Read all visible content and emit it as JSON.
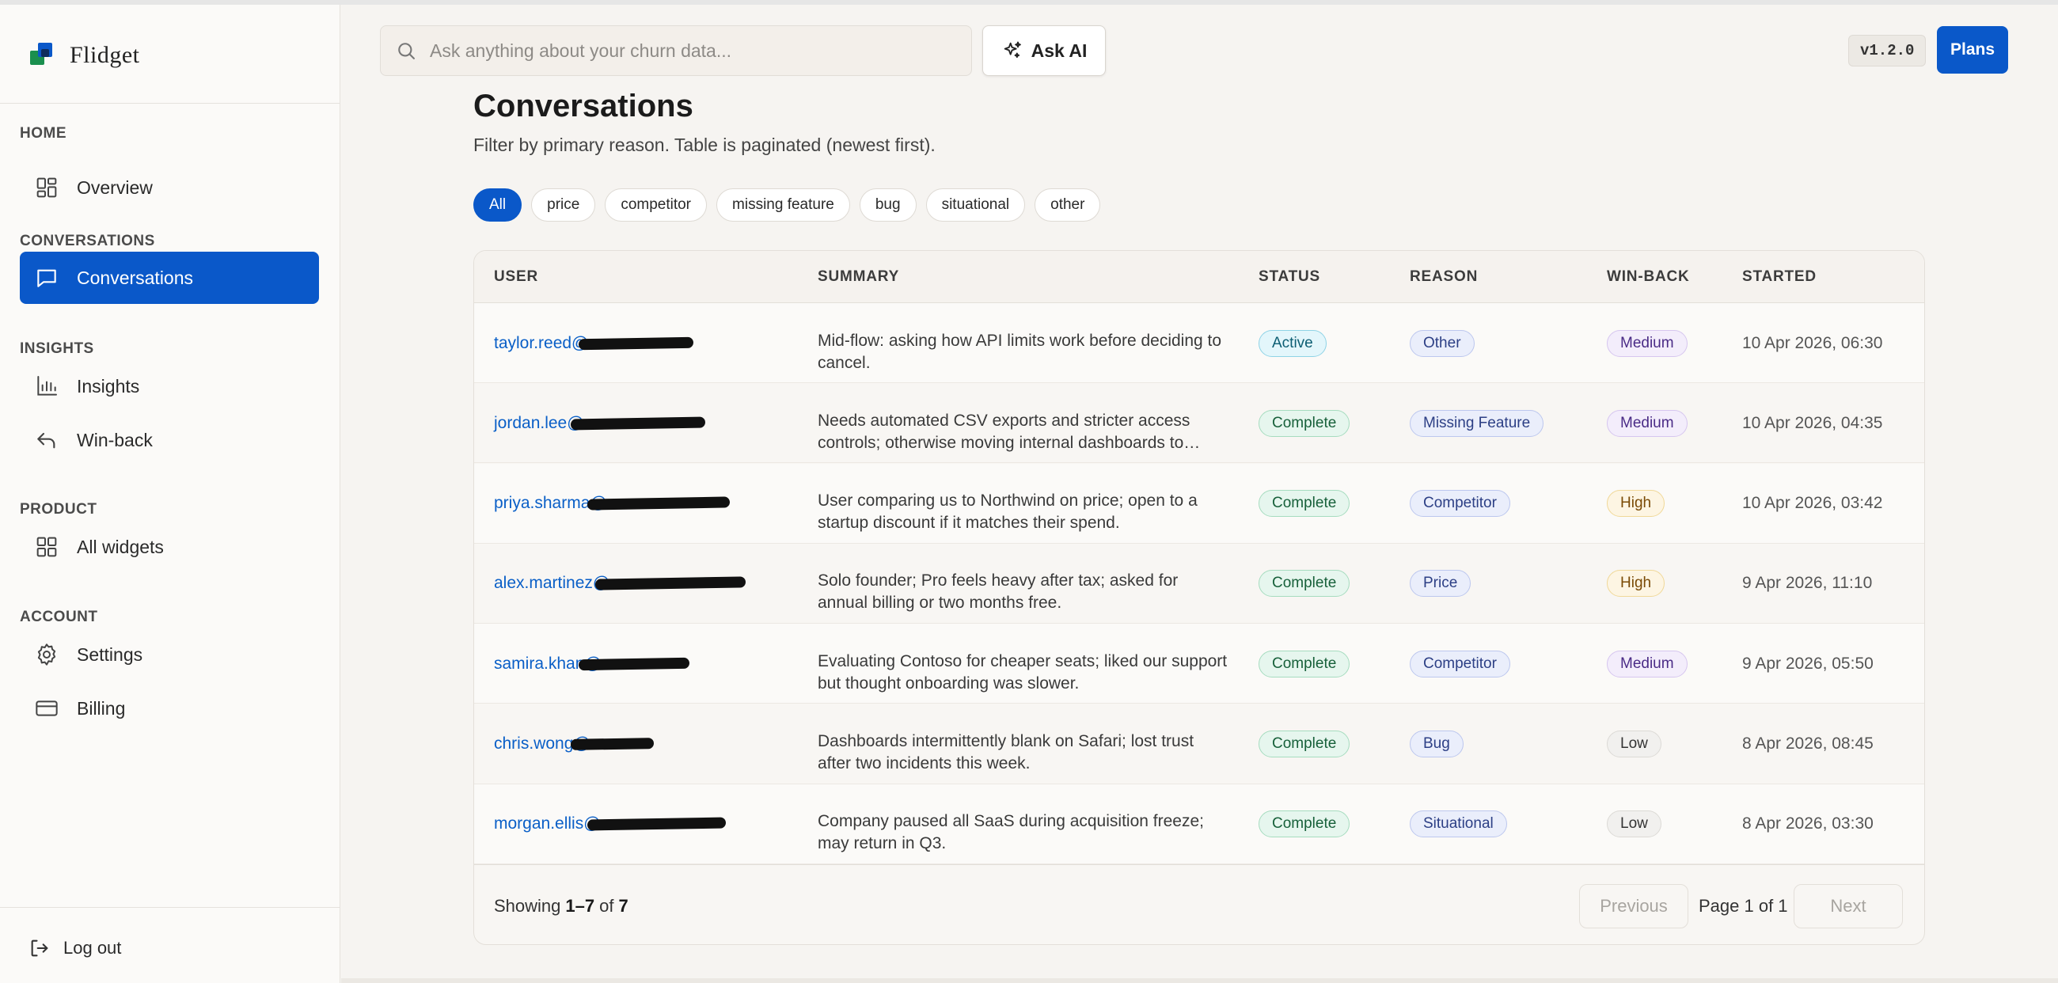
{
  "app": {
    "name": "Flidget",
    "version": "v1.2.0"
  },
  "colors": {
    "primary": "#0a58c9",
    "link": "#0a5fc7"
  },
  "sidebar": {
    "sections": [
      {
        "heading": "HOME",
        "items": [
          {
            "label": "Overview",
            "icon": "grid-icon",
            "active": false
          }
        ]
      },
      {
        "heading": "CONVERSATIONS",
        "items": [
          {
            "label": "Conversations",
            "icon": "chat-icon",
            "active": true
          }
        ]
      },
      {
        "heading": "INSIGHTS",
        "items": [
          {
            "label": "Insights",
            "icon": "bar-chart-icon",
            "active": false
          },
          {
            "label": "Win-back",
            "icon": "undo-icon",
            "active": false
          }
        ]
      },
      {
        "heading": "PRODUCT",
        "items": [
          {
            "label": "All widgets",
            "icon": "widgets-grid-icon",
            "active": false
          }
        ]
      },
      {
        "heading": "ACCOUNT",
        "items": [
          {
            "label": "Settings",
            "icon": "gear-icon",
            "active": false
          },
          {
            "label": "Billing",
            "icon": "credit-card-icon",
            "active": false
          }
        ]
      }
    ],
    "logout_label": "Log out"
  },
  "topbar": {
    "search_placeholder": "Ask anything about your churn data...",
    "ask_ai_label": "Ask AI",
    "plans_label": "Plans"
  },
  "main": {
    "title": "Conversations",
    "subtitle": "Filter by primary reason. Table is paginated (newest first).",
    "filters": [
      {
        "label": "All",
        "active": true
      },
      {
        "label": "price",
        "active": false
      },
      {
        "label": "competitor",
        "active": false
      },
      {
        "label": "missing feature",
        "active": false
      },
      {
        "label": "bug",
        "active": false
      },
      {
        "label": "situational",
        "active": false
      },
      {
        "label": "other",
        "active": false
      }
    ],
    "table": {
      "columns": [
        "USER",
        "SUMMARY",
        "STATUS",
        "REASON",
        "WIN-BACK",
        "STARTED"
      ],
      "rows": [
        {
          "user": "taylor.reed@",
          "summary": "Mid-flow: asking how API limits work before deciding to cancel.",
          "status": "Active",
          "reason": "Other",
          "winback": "Medium",
          "started": "10 Apr 2026, 06:30"
        },
        {
          "user": "jordan.lee@",
          "summary": "Needs automated CSV exports and stricter access controls; otherwise moving internal dashboards to…",
          "status": "Complete",
          "reason": "Missing Feature",
          "winback": "Medium",
          "started": "10 Apr 2026, 04:35"
        },
        {
          "user": "priya.sharma@",
          "summary": "User comparing us to Northwind on price; open to a startup discount if it matches their spend.",
          "status": "Complete",
          "reason": "Competitor",
          "winback": "High",
          "started": "10 Apr 2026, 03:42"
        },
        {
          "user": "alex.martinez@",
          "summary": "Solo founder; Pro feels heavy after tax; asked for annual billing or two months free.",
          "status": "Complete",
          "reason": "Price",
          "winback": "High",
          "started": "9 Apr 2026, 11:10"
        },
        {
          "user": "samira.khan@",
          "summary": "Evaluating Contoso for cheaper seats; liked our support but thought onboarding was slower.",
          "status": "Complete",
          "reason": "Competitor",
          "winback": "Medium",
          "started": "9 Apr 2026, 05:50"
        },
        {
          "user": "chris.wong@",
          "summary": "Dashboards intermittently blank on Safari; lost trust after two incidents this week.",
          "status": "Complete",
          "reason": "Bug",
          "winback": "Low",
          "started": "8 Apr 2026, 08:45"
        },
        {
          "user": "morgan.ellis@",
          "summary": "Company paused all SaaS during acquisition freeze; may return in Q3.",
          "status": "Complete",
          "reason": "Situational",
          "winback": "Low",
          "started": "8 Apr 2026, 03:30"
        }
      ]
    },
    "pagination": {
      "showing_prefix": "Showing",
      "showing_range": "1–7",
      "showing_of": "of",
      "showing_total": "7",
      "previous_label": "Previous",
      "page_info": "Page 1 of 1",
      "next_label": "Next"
    }
  }
}
